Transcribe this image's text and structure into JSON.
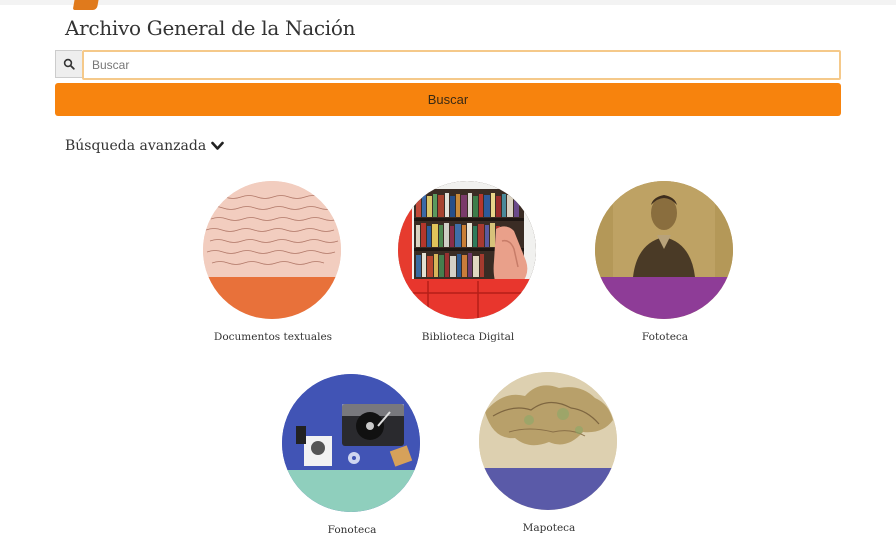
{
  "header": {
    "title": "Archivo General de la Nación",
    "logo": "archive-book-logo"
  },
  "search": {
    "icon": "search-icon",
    "placeholder": "Buscar",
    "value": "",
    "button_label": "Buscar"
  },
  "advanced": {
    "label": "Búsqueda avanzada",
    "icon": "chevron-down-icon"
  },
  "collections": [
    {
      "label": "Documentos textuales",
      "image": "handwritten-manuscript",
      "band_color": "#e8713a"
    },
    {
      "label": "Biblioteca Digital",
      "image": "bookshelf",
      "band_color": "#e8362d"
    },
    {
      "label": "Fototeca",
      "image": "sepia-portrait",
      "band_color": "#8e3c97"
    },
    {
      "label": "Fonoteca",
      "image": "record-player",
      "band_color": "#8fcfbd"
    },
    {
      "label": "Mapoteca",
      "image": "old-map",
      "band_color": "#5a5aa8"
    }
  ],
  "colors": {
    "accent": "#f7830d",
    "title_text": "#333333"
  }
}
